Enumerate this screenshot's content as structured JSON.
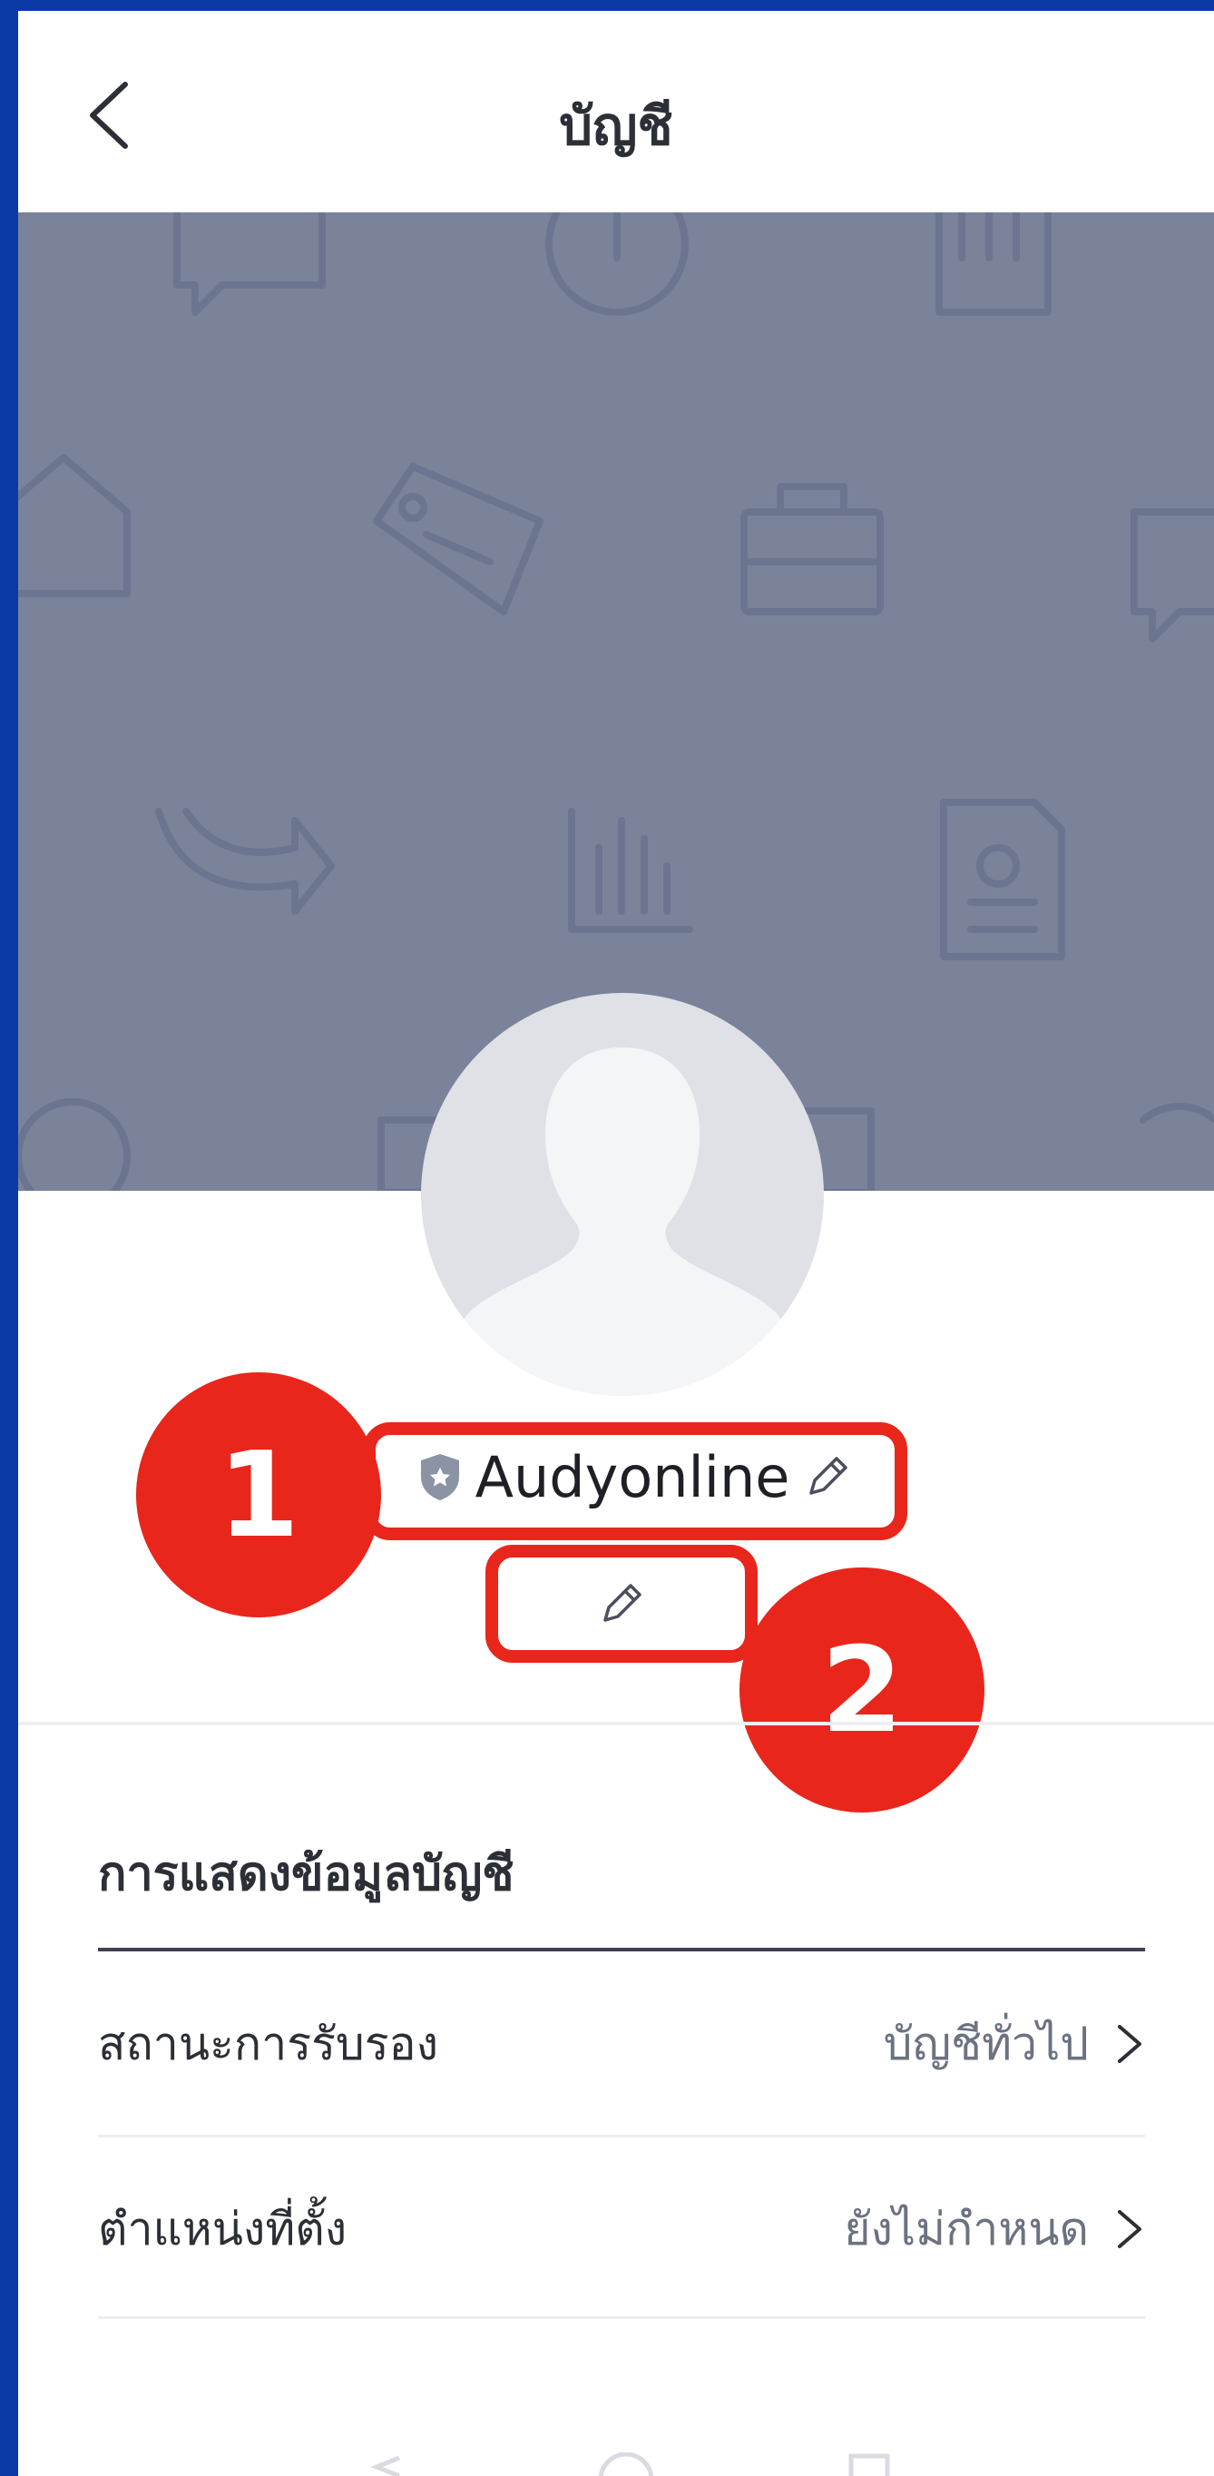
{
  "header": {
    "title": "บัญชี",
    "back_icon": "chevron-left-icon"
  },
  "profile": {
    "display_name": "Audyonline",
    "badge_icon": "shield-icon",
    "edit_name_icon": "pencil-icon",
    "edit_status_icon": "pencil-icon"
  },
  "annotations": {
    "badge_1": "1",
    "badge_2": "2",
    "color": "#e8261b"
  },
  "account_section": {
    "title": "การแสดงข้อมูลบัญชี",
    "rows": [
      {
        "label": "สถานะการรับรอง",
        "value": "บัญชีทั่วไป",
        "icon": "chevron-right-icon"
      },
      {
        "label": "ตำแหน่งที่ตั้ง",
        "value": "ยังไม่กำหนด",
        "icon": "chevron-right-icon"
      }
    ]
  },
  "colors": {
    "frame": "#0b3aa6",
    "cover": "#7a8399",
    "avatar_bg": "#dfe1e6"
  }
}
